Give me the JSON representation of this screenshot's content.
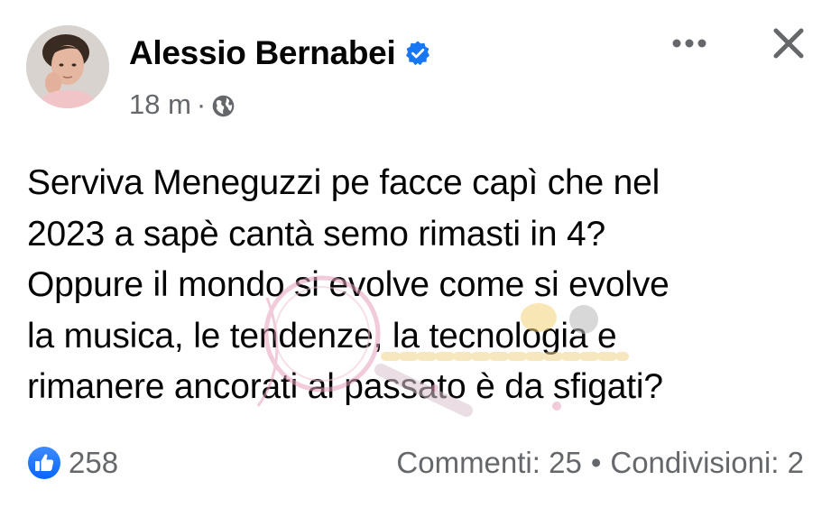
{
  "post": {
    "author": "Alessio Bernabei",
    "verified": true,
    "timestamp": "18 m",
    "meta_separator": "·",
    "audience_icon": "globe-icon",
    "menu_icon": "more-horizontal-icon",
    "close_icon": "close-icon",
    "text": "Serviva Meneguzzi pe facce capì che nel\n2023 a sapè cantà semo rimasti in 4?\nOppure il mondo si evolve come si evolve\nla musica, le tendenze, la tecnologia e\nrimanere ancorati al passato è da sfigati?",
    "reactions": {
      "icon": "like-icon",
      "count": "258"
    },
    "comments": "Commenti: 25",
    "stats_separator": "•",
    "shares": "Condivisioni: 2"
  },
  "colors": {
    "primary_text": "#050505",
    "secondary_text": "#65676b",
    "accent_blue": "#1877f2",
    "background": "#ffffff"
  }
}
